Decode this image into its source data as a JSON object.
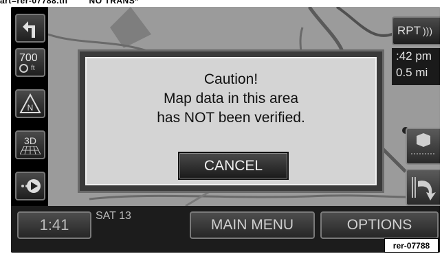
{
  "header_note": "art=rer-07788.tif        NO TRANS*",
  "left_panel": {
    "scale_value": "700",
    "scale_unit": "ft",
    "compass_letter": "N",
    "view_mode": "3D"
  },
  "top_right": {
    "repeat_label": "RPT",
    "eta_time": ":42 pm",
    "distance": "0.5 mi"
  },
  "dialog": {
    "line1": "Caution!",
    "line2": "Map data in this area",
    "line3": "has NOT been verified.",
    "cancel_label": "CANCEL"
  },
  "bottom_bar": {
    "clock": "1:41",
    "date": "SAT 13",
    "main_menu_label": "MAIN MENU",
    "options_label": "OPTIONS"
  },
  "image_label": "rer-07788"
}
